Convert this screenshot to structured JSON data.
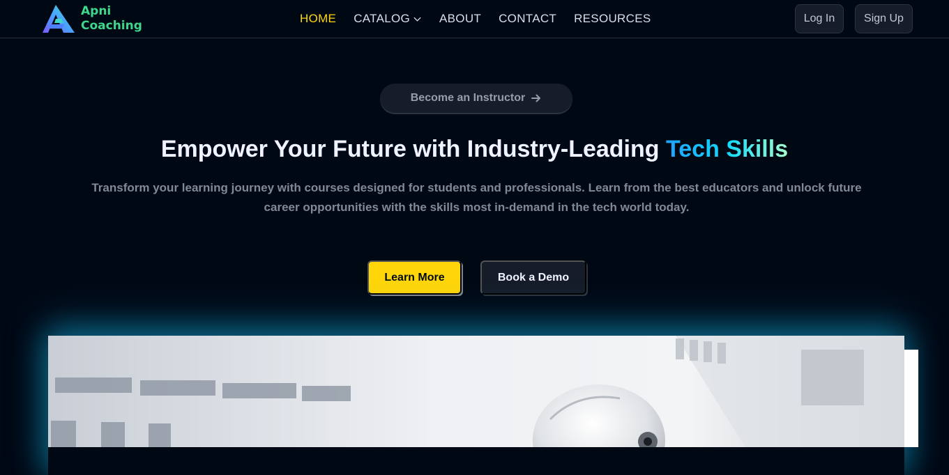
{
  "brand": {
    "line1": "Apni",
    "line2": "Coaching",
    "color": "#3fd78c"
  },
  "nav": {
    "links": [
      {
        "label": "HOME",
        "active": true
      },
      {
        "label": "CATALOG",
        "dropdown": true
      },
      {
        "label": "ABOUT"
      },
      {
        "label": "CONTACT"
      },
      {
        "label": "RESOURCES"
      }
    ],
    "login_label": "Log In",
    "signup_label": "Sign Up"
  },
  "hero": {
    "instructor_label": "Become an Instructor",
    "headline_main": "Empower Your Future with Industry-Leading ",
    "headline_highlight": "Tech Skills",
    "subtext": "Transform your learning journey with courses designed for students and professionals. Learn from the best educators and unlock future career opportunities with the skills most in-demand in the tech world today.",
    "cta_primary": "Learn More",
    "cta_secondary": "Book a Demo"
  },
  "colors": {
    "background": "#000814",
    "accent_yellow": "#ffd60a",
    "highlight_gradient": [
      "#1fa2ff",
      "#12d8fa",
      "#a6ffcb"
    ]
  },
  "icons": {
    "logo": "triangle-a-logo-icon",
    "dropdown": "chevron-down-icon",
    "arrow": "arrow-right-icon"
  }
}
